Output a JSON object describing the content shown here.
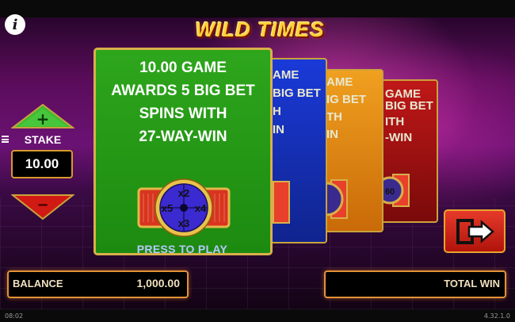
{
  "game": {
    "logo": "WILD TIMES"
  },
  "stake": {
    "label": "STAKE",
    "value": "10.00",
    "increase_symbol": "+",
    "decrease_symbol": "−"
  },
  "cards": {
    "selected": {
      "line1": "10.00 GAME",
      "line2": "AWARDS 5 BIG BET",
      "line3": "SPINS WITH",
      "line4": "27-WAY-WIN",
      "multipliers": [
        "x2",
        "x4",
        "x3",
        "x5"
      ],
      "cta": "PRESS TO PLAY",
      "color": "#2ea61c"
    },
    "blue": {
      "line1": "AME",
      "line2": "BIG BET",
      "line3": "H",
      "line4": "IN",
      "color": "#1a3ad8"
    },
    "orange": {
      "line1": "AME",
      "line2": "IG BET",
      "line3": "TH",
      "line4": "IN",
      "color": "#f0a020"
    },
    "red": {
      "line1": "GAME",
      "line2": "BIG BET",
      "line3": "ITH",
      "line4": "-WIN",
      "wheel_digits": "60",
      "color": "#c01818"
    }
  },
  "balance": {
    "label": "BALANCE",
    "value": "1,000.00"
  },
  "total_win": {
    "label": "TOTAL WIN"
  },
  "footer": {
    "time": "08:02",
    "version": "4.32.1.0"
  },
  "icons": {
    "info": "info-icon",
    "menu": "hamburger-menu-icon",
    "exit": "exit-icon",
    "plus": "plus-arrow-icon",
    "minus": "minus-arrow-icon"
  },
  "colors": {
    "accent_gold": "#d8b04a",
    "panel_border": "#e29238",
    "cta_blue": "#b7c8ff"
  }
}
